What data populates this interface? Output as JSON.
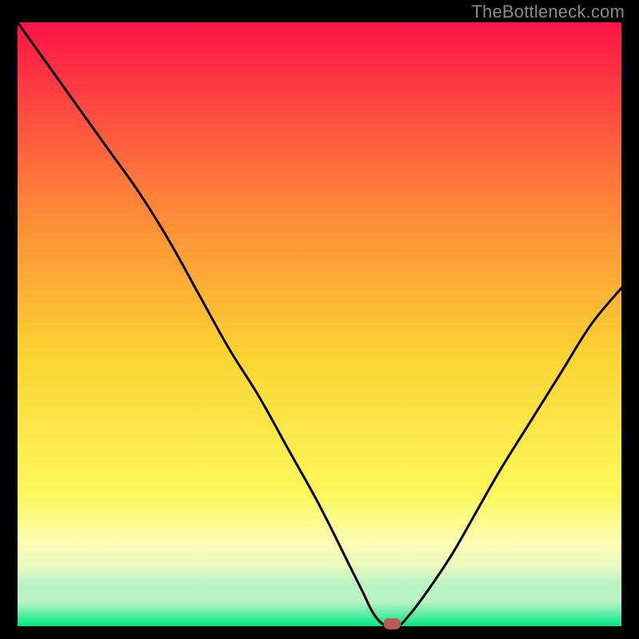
{
  "watermark": "TheBottleneck.com",
  "colors": {
    "gradient_top": "#fd1346",
    "gradient_mid_upper": "#ff7d3a",
    "gradient_mid": "#fbd331",
    "gradient_mid_lower": "#fcf85a",
    "gradient_low1": "#fdfdb3",
    "gradient_low2": "#e9fac0",
    "gradient_low3": "#b8f3c3",
    "gradient_bottom": "#00e682",
    "curve": "#000000",
    "marker": "#b9594f"
  },
  "chart_data": {
    "type": "line",
    "title": "",
    "xlabel": "",
    "ylabel": "",
    "xlim": [
      0,
      100
    ],
    "ylim": [
      0,
      100
    ],
    "grid": false,
    "legend": false,
    "series": [
      {
        "name": "bottleneck-curve",
        "x": [
          0,
          5,
          10,
          15,
          20,
          25,
          30,
          35,
          40,
          45,
          50,
          55,
          57,
          59,
          61,
          63,
          65,
          68,
          72,
          76,
          80,
          85,
          90,
          95,
          100
        ],
        "values": [
          100,
          93,
          86,
          79,
          72,
          64,
          55,
          46,
          38,
          29,
          20,
          10,
          6,
          2,
          0,
          0,
          2,
          6,
          12,
          19,
          26,
          34,
          42,
          50,
          56
        ],
        "segment_style": [
          "curve",
          "curve",
          "curve",
          "curve",
          "curve",
          "curve",
          "curve",
          "curve",
          "curve",
          "curve",
          "curve",
          "curve",
          "curve",
          "curve",
          "flat",
          "flat",
          "curve",
          "curve",
          "curve",
          "curve",
          "curve",
          "curve",
          "curve",
          "curve",
          "curve"
        ]
      }
    ],
    "marker": {
      "x": 62,
      "y": 0.4
    },
    "gradient_stops_pct": [
      0,
      28,
      55,
      78,
      86,
      90,
      93,
      96,
      100
    ]
  }
}
